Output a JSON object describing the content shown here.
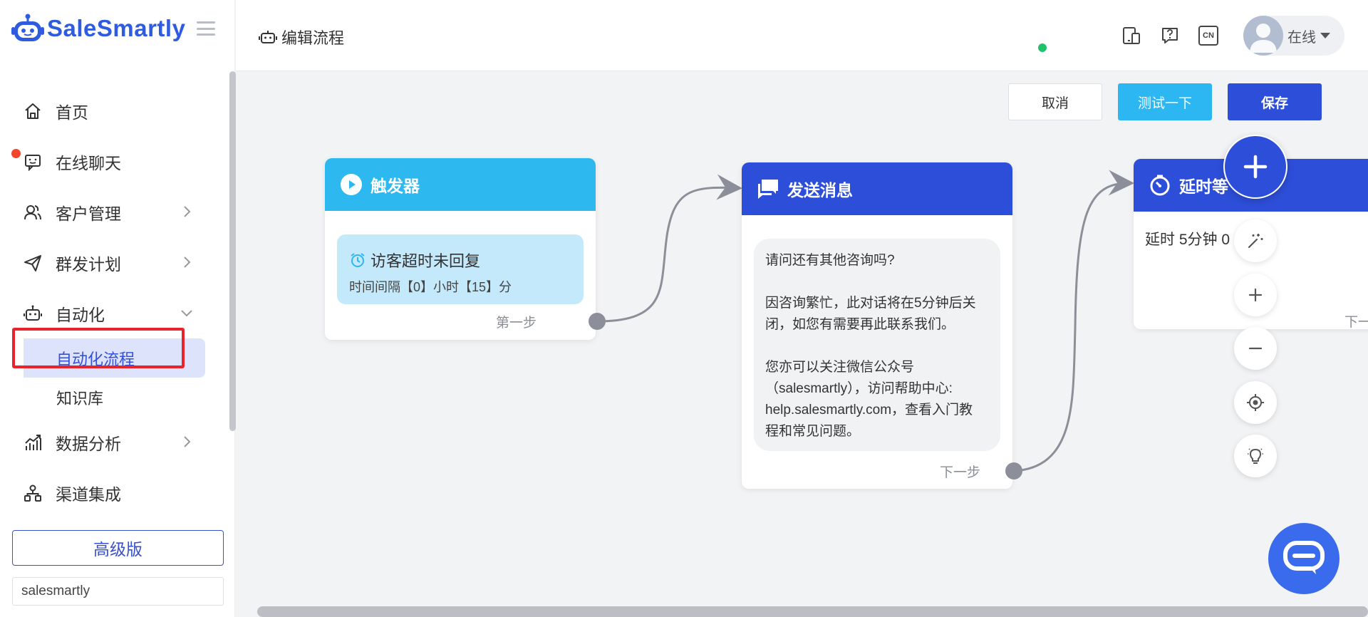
{
  "brand": {
    "name": "SaleSmartly"
  },
  "sidebar": {
    "items": [
      {
        "label": "首页",
        "icon": "home-icon"
      },
      {
        "label": "在线聊天",
        "icon": "chat-icon"
      },
      {
        "label": "客户管理",
        "icon": "users-icon"
      },
      {
        "label": "群发计划",
        "icon": "send-icon"
      },
      {
        "label": "自动化",
        "icon": "robot-icon"
      }
    ],
    "sub_items": [
      {
        "label": "自动化流程"
      },
      {
        "label": "知识库"
      }
    ],
    "items_after": [
      {
        "label": "数据分析",
        "icon": "analytics-icon"
      },
      {
        "label": "渠道集成",
        "icon": "integration-icon"
      }
    ],
    "plan_button": "高级版",
    "workspace_value": "salesmartly"
  },
  "header": {
    "title": "编辑流程",
    "language": "CN",
    "user_status": "在线"
  },
  "toolbar": {
    "cancel_label": "取消",
    "test_label": "测试一下",
    "save_label": "保存"
  },
  "nodes": {
    "trigger": {
      "title": "触发器",
      "card_title": "访客超时未回复",
      "card_sub": "时间间隔【0】小时【15】分",
      "step_label": "第一步"
    },
    "send_message": {
      "title": "发送消息",
      "message_lines": [
        "请问还有其他咨询吗?",
        "",
        "因咨询繁忙，此对话将在5分钟后关",
        "闭，如您有需要再此联系我们。",
        "",
        "您亦可以关注微信公众号",
        "（salesmartly），访问帮助中心:",
        "help.salesmartly.com，查看入门教",
        "程和常见问题。"
      ],
      "step_label": "下一步"
    },
    "delay": {
      "title": "延时等",
      "text": "延时 5分钟 0",
      "step_label": "下一"
    }
  },
  "colors": {
    "brand": "#2f5be0",
    "trigger": "#2db8f0",
    "action": "#2d4ed8",
    "highlight": "#e8232b",
    "online": "#21c26b"
  }
}
